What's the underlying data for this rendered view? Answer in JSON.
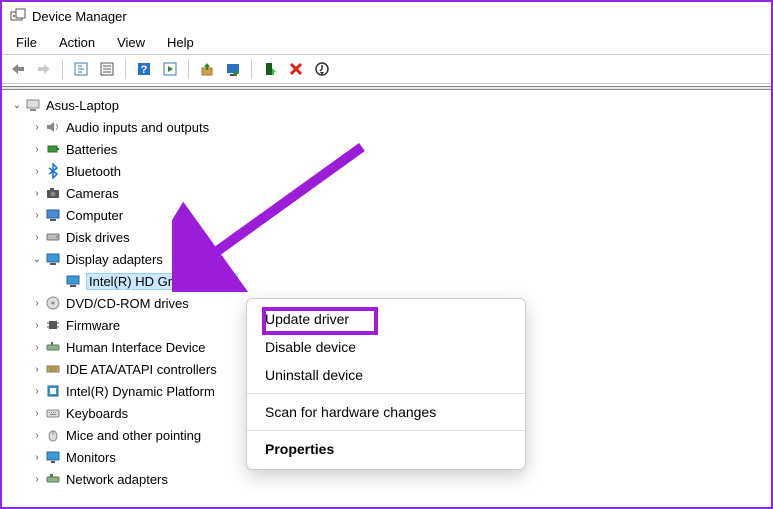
{
  "window": {
    "title": "Device Manager"
  },
  "menu": {
    "file": "File",
    "action": "Action",
    "view": "View",
    "help": "Help"
  },
  "tree": {
    "root": "Asus-Laptop",
    "items": [
      "Audio inputs and outputs",
      "Batteries",
      "Bluetooth",
      "Cameras",
      "Computer",
      "Disk drives",
      "Display adapters",
      "DVD/CD-ROM drives",
      "Firmware",
      "Human Interface Device",
      "IDE ATA/ATAPI controllers",
      "Intel(R) Dynamic Platform",
      "Keyboards",
      "Mice and other pointing",
      "Monitors",
      "Network adapters"
    ],
    "display_child": "Intel(R) HD Graphics 620"
  },
  "context_menu": {
    "update": "Update driver",
    "disable": "Disable device",
    "uninstall": "Uninstall device",
    "scan": "Scan for hardware changes",
    "properties": "Properties"
  }
}
